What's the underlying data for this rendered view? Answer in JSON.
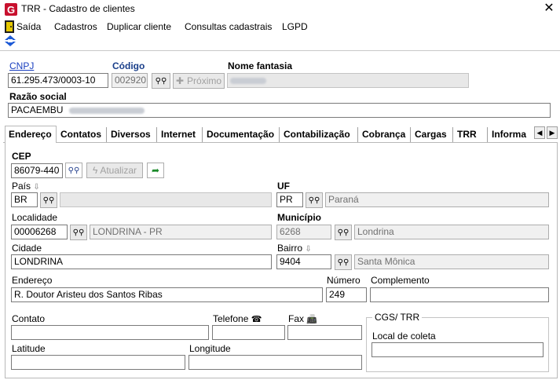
{
  "window": {
    "title": "TRR - Cadastro de clientes",
    "close_glyph": "✕"
  },
  "menu": {
    "items": [
      "Saída",
      "Cadastros",
      "Duplicar cliente",
      "Consultas cadastrais",
      "LGPD"
    ]
  },
  "header": {
    "cnpj_label": "CNPJ",
    "cnpj_value": "61.295.473/0003-10",
    "codigo_label": "Código",
    "codigo_value": "002920",
    "proximo_label": "Próximo",
    "nome_fantasia_label": "Nome fantasia",
    "razao_social_label": "Razão social",
    "razao_social_value": "PACAEMBU"
  },
  "tabs": [
    "Endereço",
    "Contatos",
    "Diversos",
    "Internet",
    "Documentação",
    "Contabilização",
    "Cobrança",
    "Cargas",
    "TRR",
    "Informa"
  ],
  "endereco": {
    "cep_label": "CEP",
    "cep_value": "86079-440",
    "atualizar_label": "Atualizar",
    "pais_label": "País",
    "pais_value": "BR",
    "uf_label": "UF",
    "uf_value": "PR",
    "uf_name": "Paraná",
    "localidade_label": "Localidade",
    "localidade_value": "00006268",
    "localidade_name": "LONDRINA - PR",
    "municipio_label": "Município",
    "municipio_value": "6268",
    "municipio_name": "Londrina",
    "cidade_label": "Cidade",
    "cidade_value": "LONDRINA",
    "bairro_label": "Bairro",
    "bairro_value": "9404",
    "bairro_name": "Santa Mônica",
    "endereco_label": "Endereço",
    "endereco_value": "R. Doutor Aristeu dos Santos Ribas",
    "numero_label": "Número",
    "numero_value": "249",
    "complemento_label": "Complemento",
    "contato_label": "Contato",
    "telefone_label": "Telefone",
    "fax_label": "Fax",
    "latitude_label": "Latitude",
    "longitude_label": "Longitude",
    "cgs_group_label": "CGS/ TRR",
    "local_coleta_label": "Local de coleta"
  },
  "colors": {
    "link": "#1a3fbf",
    "app_icon": "#c8102e",
    "accent_blue": "#1e5bd6"
  }
}
